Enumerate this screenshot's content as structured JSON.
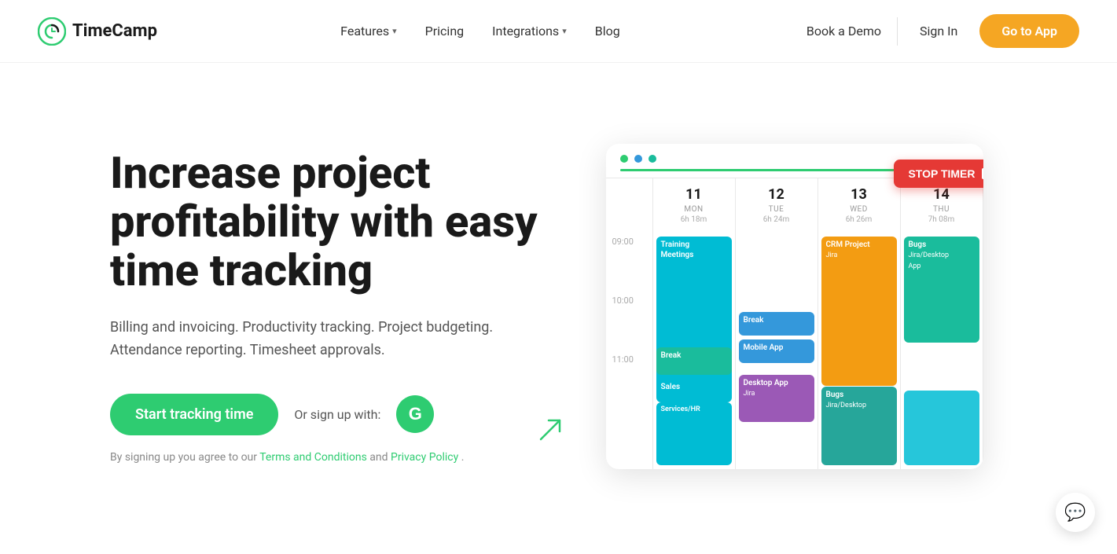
{
  "navbar": {
    "logo_text": "TimeCamp",
    "nav_items": [
      {
        "label": "Features",
        "has_dropdown": true
      },
      {
        "label": "Pricing",
        "has_dropdown": false
      },
      {
        "label": "Integrations",
        "has_dropdown": true
      },
      {
        "label": "Blog",
        "has_dropdown": false
      }
    ],
    "book_demo": "Book a Demo",
    "sign_in": "Sign In",
    "go_to_app": "Go to App"
  },
  "hero": {
    "headline": "Increase project profitability with easy time tracking",
    "subtext": "Billing and invoicing. Productivity tracking. Project budgeting. Attendance reporting. Timesheet approvals.",
    "cta_label": "Start tracking time",
    "or_sign_up": "Or sign up with:",
    "google_letter": "G",
    "terms_text": "By signing up you agree to our ",
    "terms_link": "Terms and Conditions",
    "and_text": " and ",
    "privacy_link": "Privacy Policy",
    "period": "."
  },
  "calendar": {
    "dots": [
      "green",
      "blue",
      "teal"
    ],
    "days": [
      {
        "num": "11",
        "name": "MON",
        "total": "6h 18m"
      },
      {
        "num": "12",
        "name": "TUE",
        "total": "6h 24m"
      },
      {
        "num": "13",
        "name": "WED",
        "total": "6h 26m"
      },
      {
        "num": "14",
        "name": "THU",
        "total": "7h 08m"
      }
    ],
    "time_labels": [
      "09:00",
      "10:00",
      "11:00",
      ""
    ],
    "stop_timer_label": "STOP TIMER"
  }
}
